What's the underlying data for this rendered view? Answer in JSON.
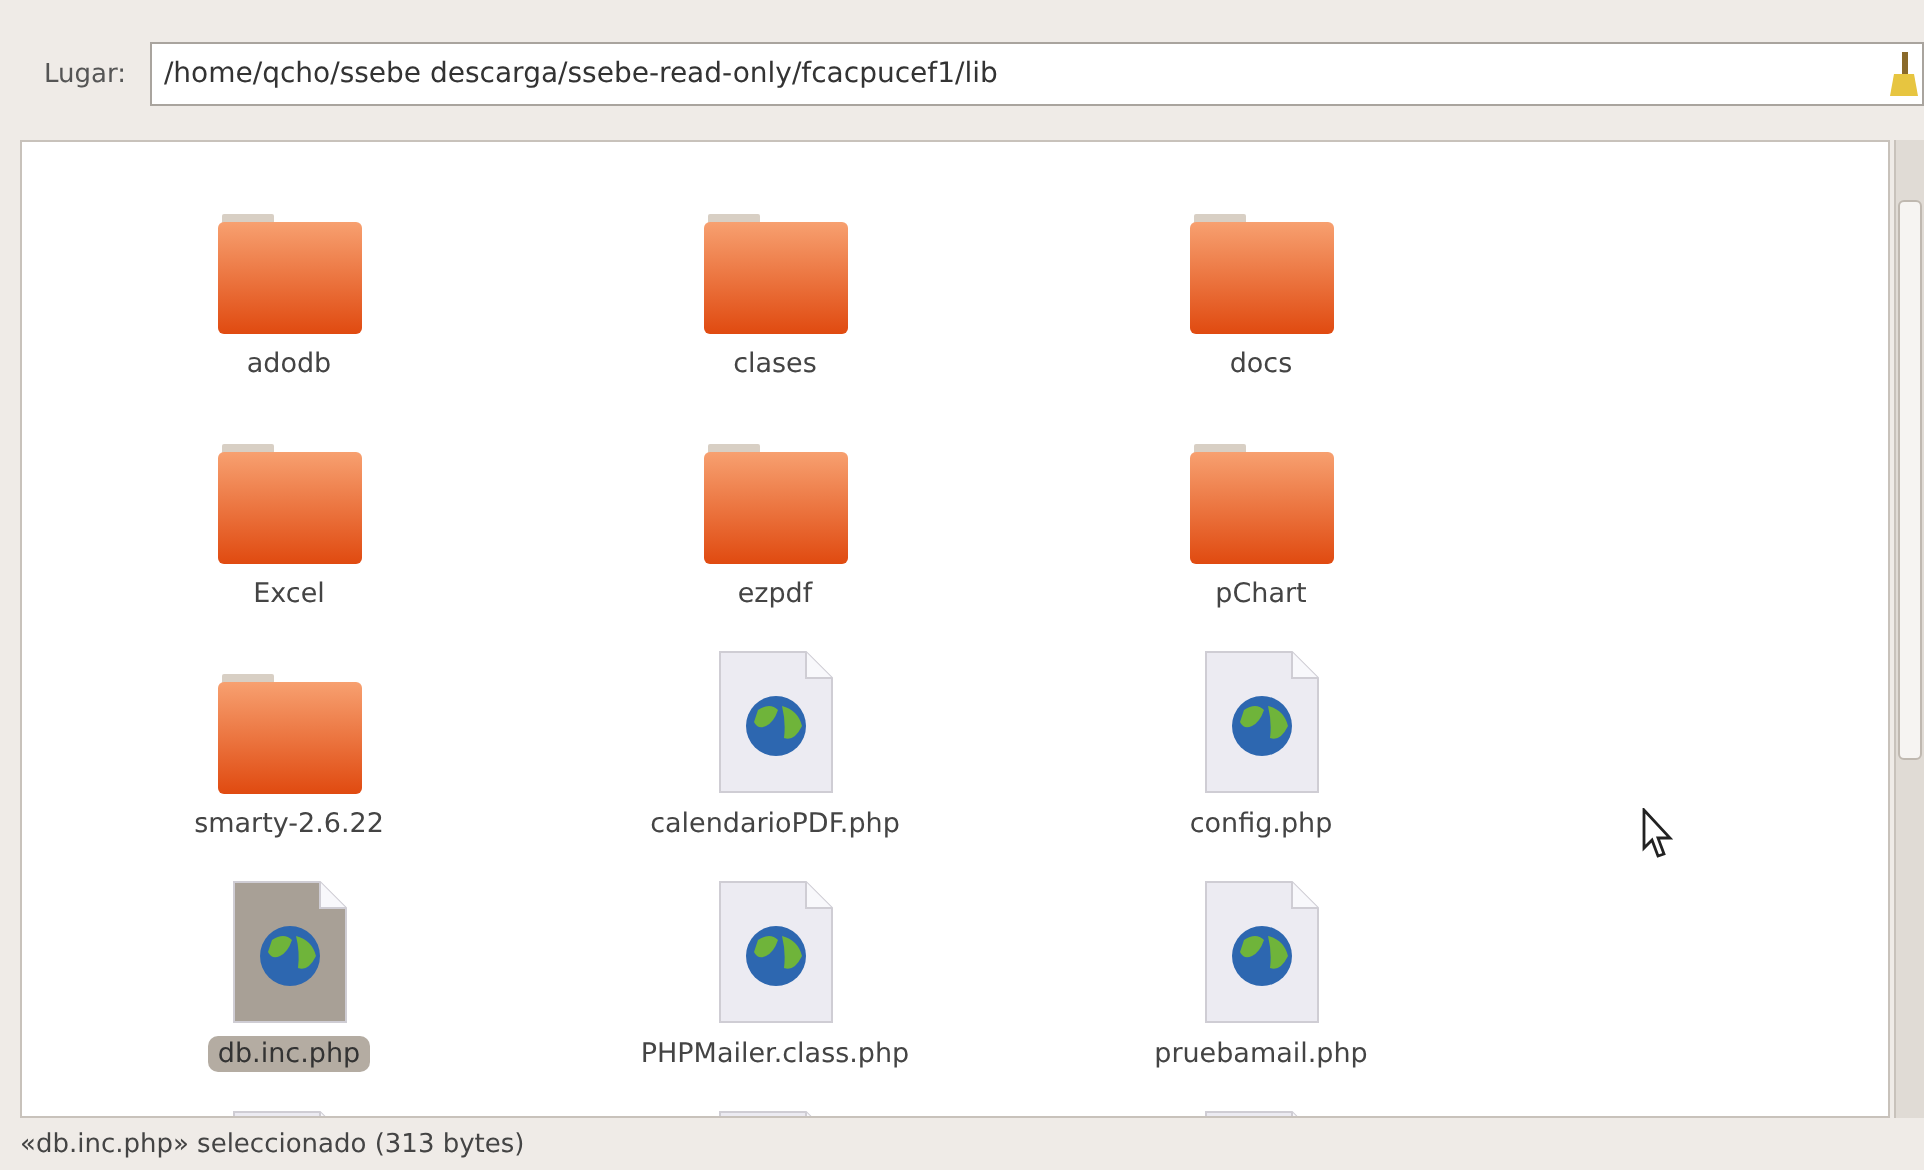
{
  "location": {
    "label": "Lugar:",
    "value": "/home/qcho/ssebe descarga/ssebe-read-only/fcacpucef1/lib"
  },
  "items": [
    {
      "kind": "folder",
      "label": "adodb",
      "selected": false
    },
    {
      "kind": "folder",
      "label": "clases",
      "selected": false
    },
    {
      "kind": "folder",
      "label": "docs",
      "selected": false
    },
    {
      "kind": "folder",
      "label": "Excel",
      "selected": false
    },
    {
      "kind": "folder",
      "label": "ezpdf",
      "selected": false
    },
    {
      "kind": "folder",
      "label": "pChart",
      "selected": false
    },
    {
      "kind": "folder",
      "label": "smarty-2.6.22",
      "selected": false
    },
    {
      "kind": "file",
      "label": "calendarioPDF.php",
      "selected": false
    },
    {
      "kind": "file",
      "label": "config.php",
      "selected": false
    },
    {
      "kind": "file",
      "label": "db.inc.php",
      "selected": true
    },
    {
      "kind": "file",
      "label": "PHPMailer.class.php",
      "selected": false
    },
    {
      "kind": "file",
      "label": "pruebamail.php",
      "selected": false
    },
    {
      "kind": "file",
      "selected": false
    },
    {
      "kind": "file",
      "selected": false
    },
    {
      "kind": "file",
      "selected": false
    }
  ],
  "status_bar": "«db.inc.php» seleccionado (313 bytes)"
}
